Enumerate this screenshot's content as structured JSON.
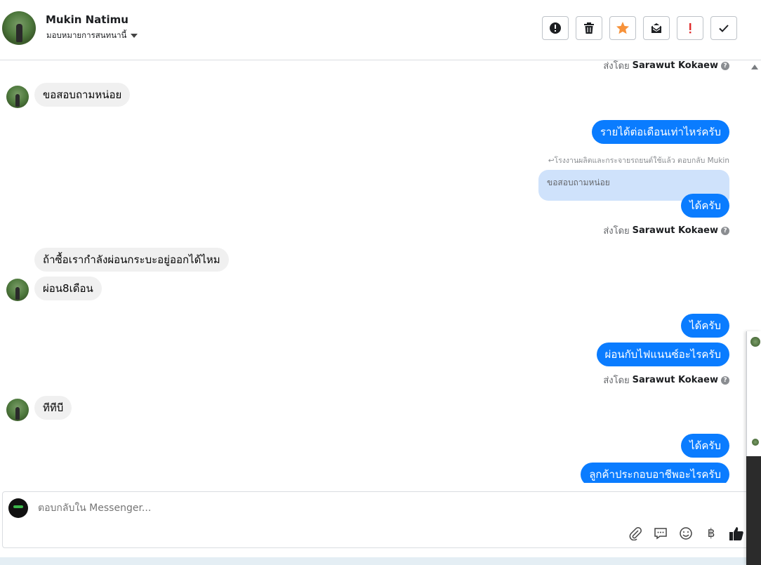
{
  "header": {
    "name": "Mukin Natimu",
    "assign_label": "มอบหมายการสนทนานี้",
    "actions": [
      "spam-icon",
      "trash-icon",
      "star-icon",
      "mail-icon",
      "important-icon",
      "check-icon"
    ]
  },
  "messages": {
    "in_1": "ขอสอบถามหน่อย",
    "out_1": "รายได้ต่อเดือนเท่าไหร่ครับ",
    "reply_label": "↩โรงงานผลิตและกระจายรถยนต์ใช้แล้ว ตอบกลับ Mukin",
    "quoted": "ขอสอบถามหน่อย",
    "out_2": "ได้ครับ",
    "in_2": "ถ้าซื้อเรากำลังผ่อนกระบะอยู่ออกได้ไหม",
    "in_3": "ผ่อน8เดือน",
    "out_3": "ได้ครับ",
    "out_4": "ผ่อนกับไฟแนนซ์อะไรครับ",
    "in_4": "ทีทีบี",
    "out_5": "ได้ครับ",
    "out_6": "ลูกค้าประกอบอาชีพอะไรครับ"
  },
  "sent_by": {
    "prefix": "ส่งโดย",
    "agent": "Sarawut Kokaew",
    "help": "?"
  },
  "composer": {
    "placeholder": "ตอบกลับใน Messenger...",
    "baht": "฿"
  },
  "colors": {
    "outgoing": "#0a7cff",
    "incoming": "#f0f0f0",
    "star": "#f7923a"
  }
}
